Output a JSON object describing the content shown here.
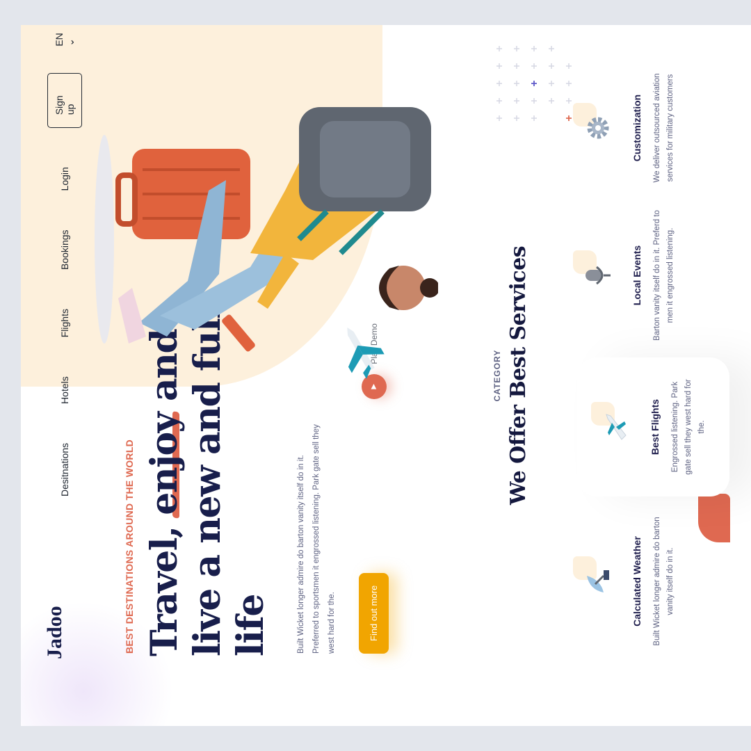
{
  "brand": {
    "logo": "Jadoo"
  },
  "nav": {
    "items": [
      "Desitnations",
      "Hotels",
      "Flights",
      "Bookings"
    ],
    "login": "Login",
    "signup": "Sign up",
    "language": "EN ⌄"
  },
  "hero": {
    "tagline": "BEST DESTINATIONS AROUND THE WORLD",
    "headline_part1": "Travel, ",
    "headline_underlined": "enjoy",
    "headline_part2": "and live a new and full life",
    "description": "Built Wicket longer admire do barton vanity itself do in it. Preferred to sportsmen it engrossed listening. Park gate sell they west hard for the.",
    "cta_label": "Find out more",
    "play_label": "Play Demo"
  },
  "category": {
    "label": "CATEGORY",
    "title": "We Offer Best Services",
    "services": [
      {
        "title": "Calculated Weather",
        "text": "Built Wicket longer admire do barton vanity itself do in it.",
        "icon": "satellite-dish-icon"
      },
      {
        "title": "Best Flights",
        "text": "Engrossed listening. Park gate sell they west hard for the.",
        "icon": "airplane-icon"
      },
      {
        "title": "Local Events",
        "text": "Barton vanity itself do in it. Preferd to men it engrossed listening.",
        "icon": "microphone-icon"
      },
      {
        "title": "Customization",
        "text": "We deliver outsourced aviation services for military customers",
        "icon": "gear-icon"
      }
    ]
  },
  "colors": {
    "navy": "#181e4b",
    "accent_orange": "#df6951",
    "cta_yellow": "#f1a501",
    "blob_cream": "#fdf0dc"
  }
}
